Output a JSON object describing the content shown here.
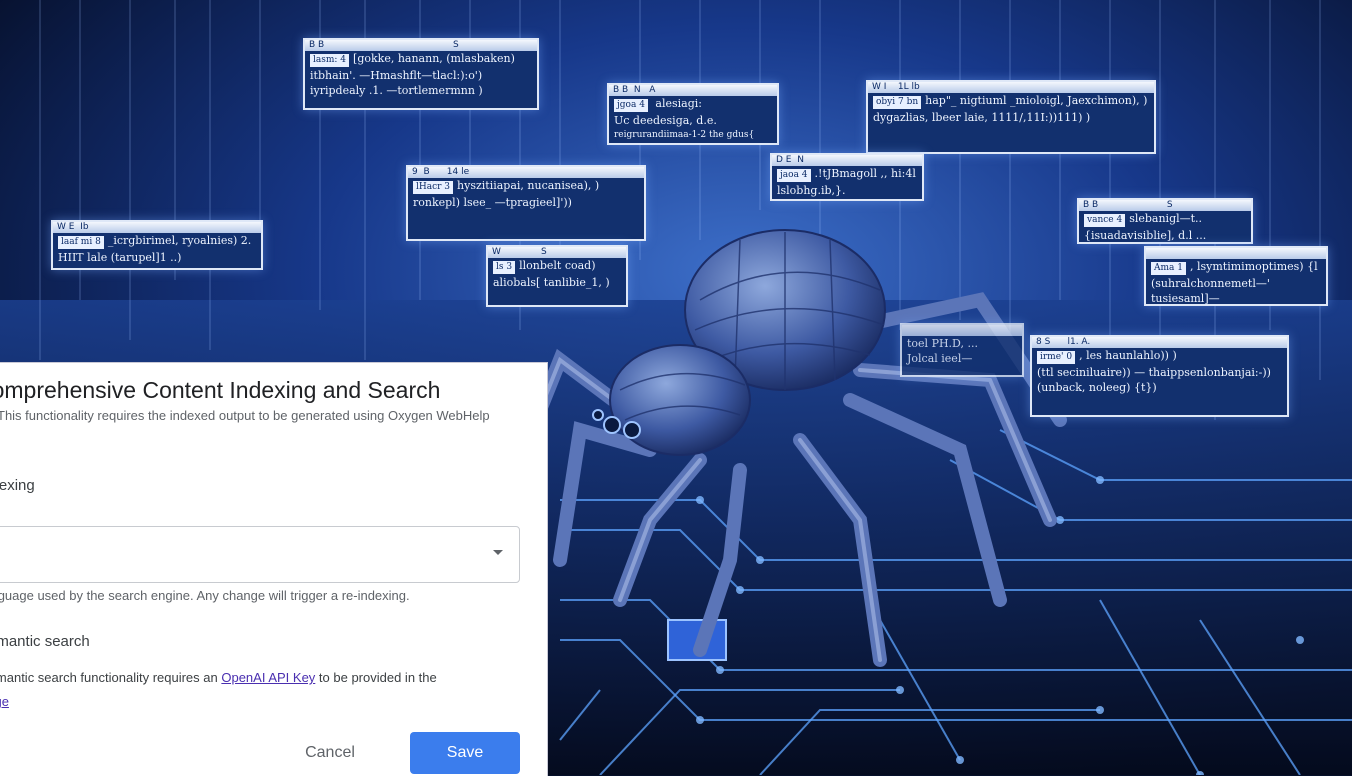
{
  "dialog": {
    "title": "Comprehensive Content Indexing and Search",
    "subtitle": "This functionality requires the indexed output to be generated using Oxygen WebHelp",
    "indexing_label": "Indexing",
    "indexing_select_value": "",
    "indexing_help": "Language used by the search engine. Any change will trigger a re-indexing.",
    "semantic_label": "Semantic search",
    "semantic_help_prefix": "Semantic search functionality requires an ",
    "semantic_help_link": "OpenAI API Key",
    "semantic_help_suffix": " to be provided in the",
    "semantic_help_link2": "page",
    "cancel_label": "Cancel",
    "save_label": "Save"
  },
  "colors": {
    "primary": "#3b7ded",
    "link": "#4a2fb0",
    "background_art": "#05102b"
  }
}
